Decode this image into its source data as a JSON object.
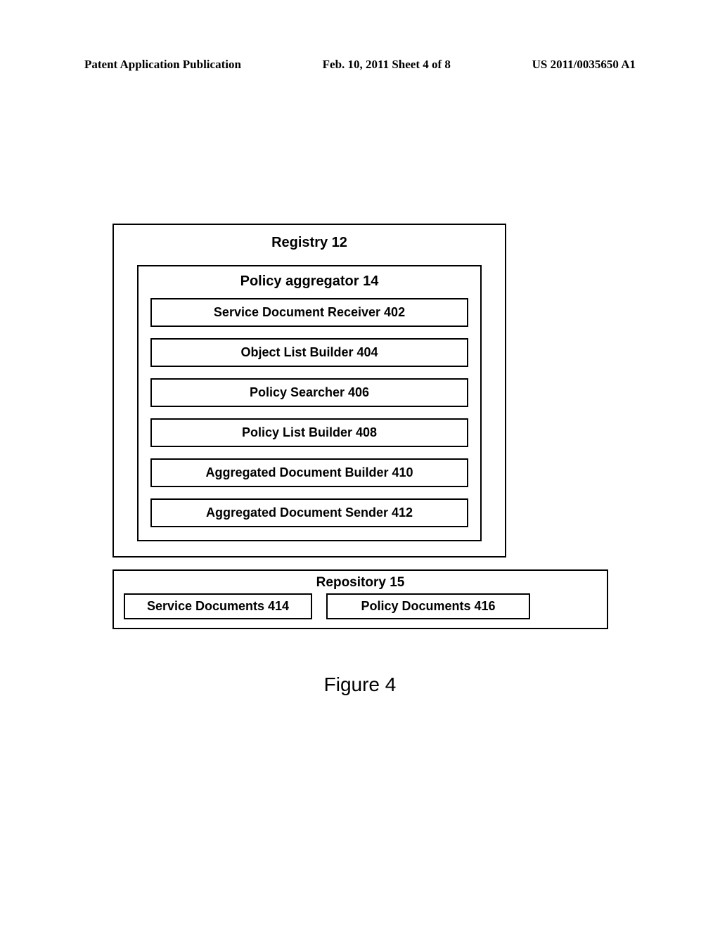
{
  "header": {
    "left": "Patent Application Publication",
    "center": "Feb. 10, 2011  Sheet 4 of 8",
    "right": "US 2011/0035650 A1"
  },
  "registry": {
    "title": "Registry 12",
    "aggregator": {
      "title": "Policy aggregator 14",
      "items": [
        "Service Document Receiver 402",
        "Object List Builder 404",
        "Policy Searcher 406",
        "Policy List Builder 408",
        "Aggregated Document Builder 410",
        "Aggregated Document Sender 412"
      ]
    }
  },
  "repository": {
    "title": "Repository 15",
    "left": "Service Documents 414",
    "right": "Policy Documents 416"
  },
  "figure_caption": "Figure 4"
}
